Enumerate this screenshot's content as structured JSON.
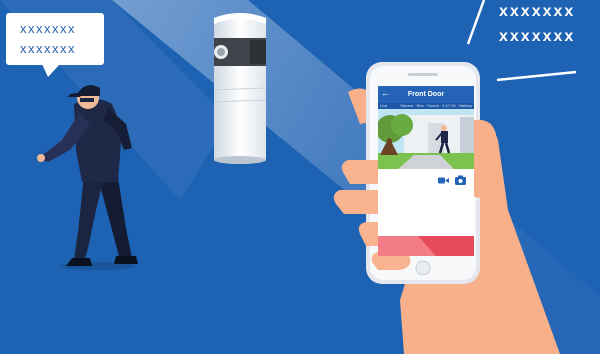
{
  "speech_bubble": {
    "lines": [
      "xxxxxxx",
      "xxxxxxx"
    ]
  },
  "corner_text": {
    "lines": [
      "xxxxxxx",
      "xxxxxxx"
    ]
  },
  "phone_app": {
    "title": "Front Door",
    "back_icon": "arrow-left-icon",
    "status_left": "Live",
    "status_right": "Stream · Rec · Sound · 4:17:09 · Battery",
    "controls": [
      "video-camera-icon",
      "camera-icon"
    ]
  },
  "colors": {
    "background": "#1e62b4",
    "app_header": "#2563b6",
    "bubble_text": "#2a61ad",
    "alert_bar": "#e74a5a",
    "skin": "#f7b08a"
  }
}
